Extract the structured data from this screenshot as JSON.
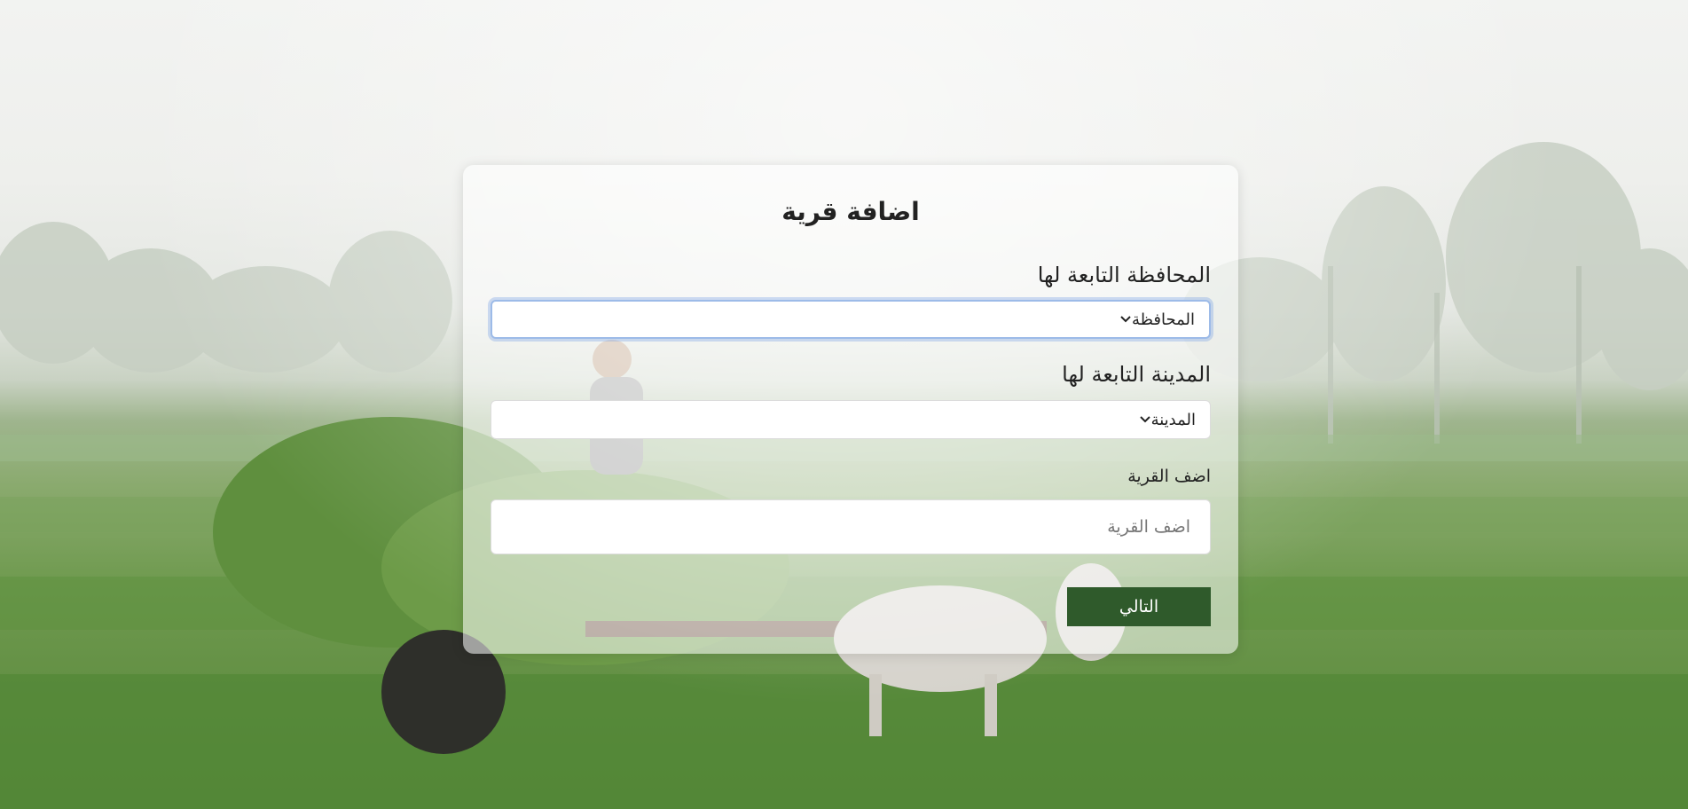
{
  "form": {
    "title": "اضافة قرية",
    "governorate_label": "المحافظة التابعة لها",
    "governorate_value": "المحافظة",
    "city_label": "المدينة التابعة لها",
    "city_value": "المدينة",
    "village_label": "اضف القرية",
    "village_placeholder": "اضف القرية",
    "next_label": "التالي"
  },
  "background": {
    "icon": "farm-field-photo"
  },
  "colors": {
    "button": "#2f5a2b",
    "focus_ring": "#9dbbe8"
  }
}
